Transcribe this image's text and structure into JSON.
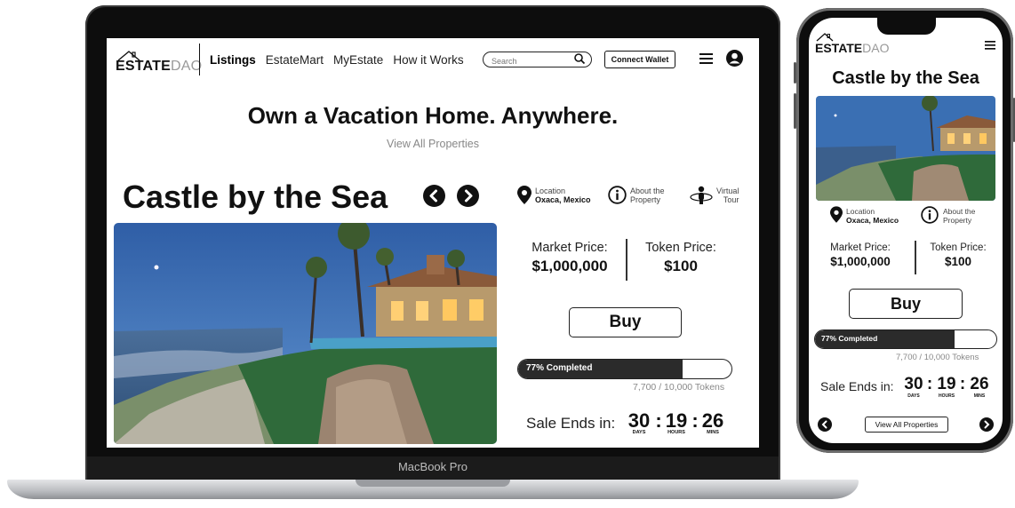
{
  "brand": {
    "bold": "ESTATE",
    "light": "DAO"
  },
  "nav": {
    "links": [
      "Listings",
      "EstateMart",
      "MyEstate",
      "How it Works"
    ],
    "search_placeholder": "Search",
    "connect_label": "Connect Wallet"
  },
  "hero": {
    "title": "Own a Vacation Home. Anywhere.",
    "link": "View All Properties"
  },
  "property": {
    "name": "Castle by the Sea",
    "location_label": "Location",
    "location_value": "Oxaca, Mexico",
    "about_line1": "About the",
    "about_line2": "Property",
    "tour_line1": "Virtual",
    "tour_line2": "Tour"
  },
  "prices": {
    "market_label": "Market Price:",
    "market_value": "$1,000,000",
    "token_label": "Token Price:",
    "token_value": "$100"
  },
  "buy_label": "Buy",
  "progress": {
    "percent": 77,
    "label": "77% Completed",
    "tokens": "7,700 / 10,000 Tokens"
  },
  "sale": {
    "label": "Sale Ends in:",
    "days": "30",
    "hours": "19",
    "mins": "26",
    "days_unit": "DAYS",
    "hours_unit": "HOURS",
    "mins_unit": "MINS",
    "sep": ":"
  },
  "laptop_model": "MacBook Pro",
  "mobile": {
    "view_all": "View All Properties"
  },
  "colors": {
    "dark": "#111111",
    "progress_fill": "#2b2b2b",
    "muted": "#888888"
  }
}
